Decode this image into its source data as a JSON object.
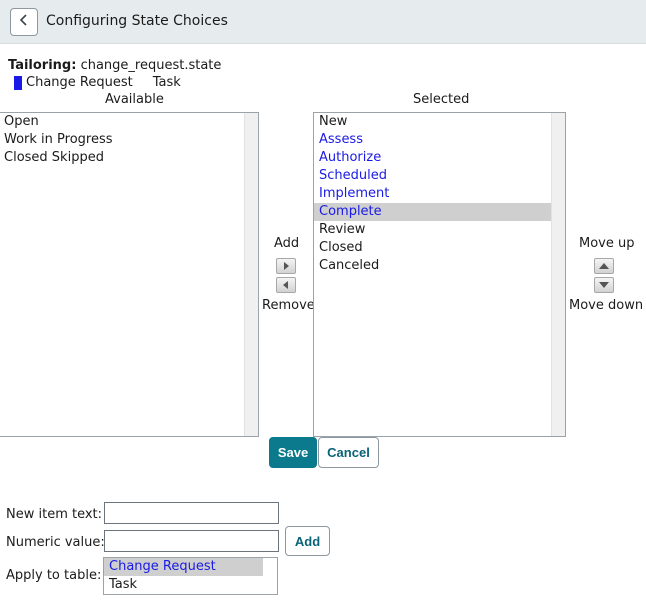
{
  "header": {
    "title": "Configuring State Choices"
  },
  "tailoring": {
    "label": "Tailoring:",
    "value": "change_request.state"
  },
  "legend": {
    "primary": "Change Request",
    "secondary": "Task",
    "primary_color": "#1a1ae6"
  },
  "available": {
    "heading": "Available",
    "items": [
      "Open",
      "Work in Progress",
      "Closed Skipped"
    ]
  },
  "selected": {
    "heading": "Selected",
    "items": [
      {
        "label": "New",
        "table": "task"
      },
      {
        "label": "Assess",
        "table": "change_request"
      },
      {
        "label": "Authorize",
        "table": "change_request"
      },
      {
        "label": "Scheduled",
        "table": "change_request"
      },
      {
        "label": "Implement",
        "table": "change_request"
      },
      {
        "label": "Complete",
        "table": "change_request",
        "selected": true
      },
      {
        "label": "Review",
        "table": "task"
      },
      {
        "label": "Closed",
        "table": "task"
      },
      {
        "label": "Canceled",
        "table": "task"
      }
    ]
  },
  "transfer": {
    "add_label": "Add",
    "remove_label": "Remove"
  },
  "order": {
    "up_label": "Move up",
    "down_label": "Move down"
  },
  "actions": {
    "save": "Save",
    "cancel": "Cancel"
  },
  "form": {
    "new_item_label": "New item text:",
    "new_item_value": "",
    "numeric_label": "Numeric value:",
    "numeric_value": "",
    "add_label": "Add",
    "apply_label": "Apply to table:",
    "apply_options": [
      "Change Request",
      "Task"
    ],
    "apply_selected": "Change Request"
  },
  "colors": {
    "accent": "#0a7a8c",
    "highlight": "#cfcfcf",
    "link_blue": "#1a1ae6"
  }
}
